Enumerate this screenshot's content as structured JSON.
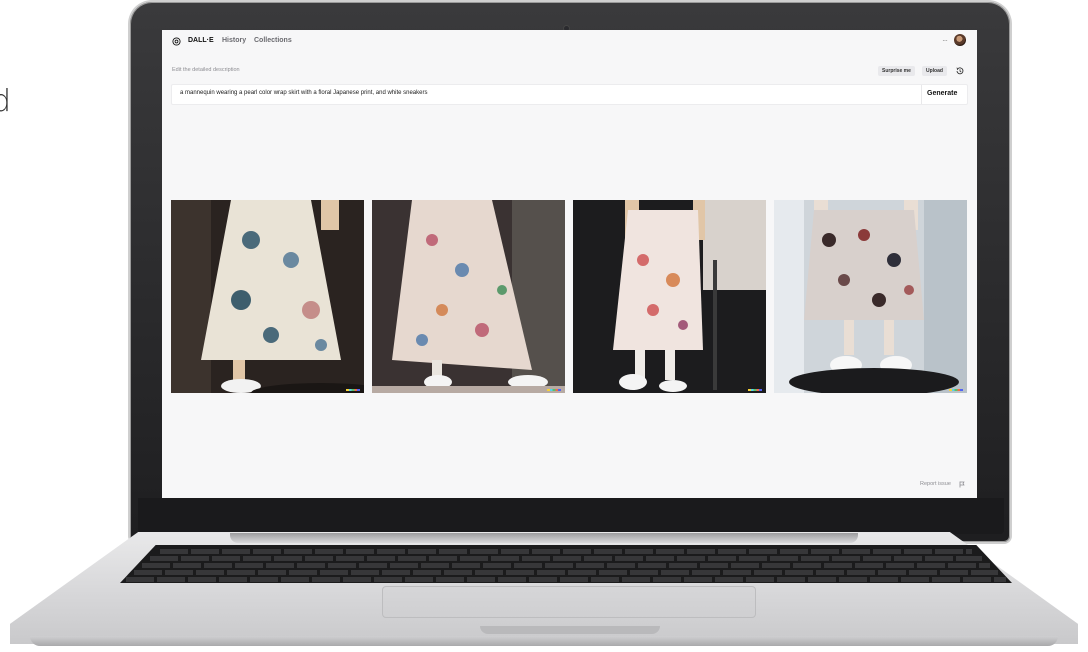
{
  "page": {
    "edge_letter": "d"
  },
  "app": {
    "brand": "DALL·E",
    "nav": [
      "History",
      "Collections"
    ],
    "more_label": "···"
  },
  "editor": {
    "label": "Edit the detailed description",
    "surprise_label": "Surprise me",
    "upload_label": "Upload",
    "prompt": "a mannequin wearing a pearl color wrap skirt with a floral Japanese print, and white sneakers",
    "generate_label": "Generate"
  },
  "gallery": {
    "images": [
      {
        "name": "result-1",
        "bg": "#2a2320",
        "skirt": "#e9e3d6",
        "accent": "#4a6a7a"
      },
      {
        "name": "result-2",
        "bg": "#3a3232",
        "skirt": "#e6d8cf",
        "accent": "#c06a7a"
      },
      {
        "name": "result-3",
        "bg": "#1c1c1e",
        "skirt": "#f0e4df",
        "accent": "#d46b6b"
      },
      {
        "name": "result-4",
        "bg": "#cfd5da",
        "skirt": "#d8d0cc",
        "accent": "#3a2a2a"
      }
    ]
  },
  "footer": {
    "report_label": "Report issue"
  }
}
